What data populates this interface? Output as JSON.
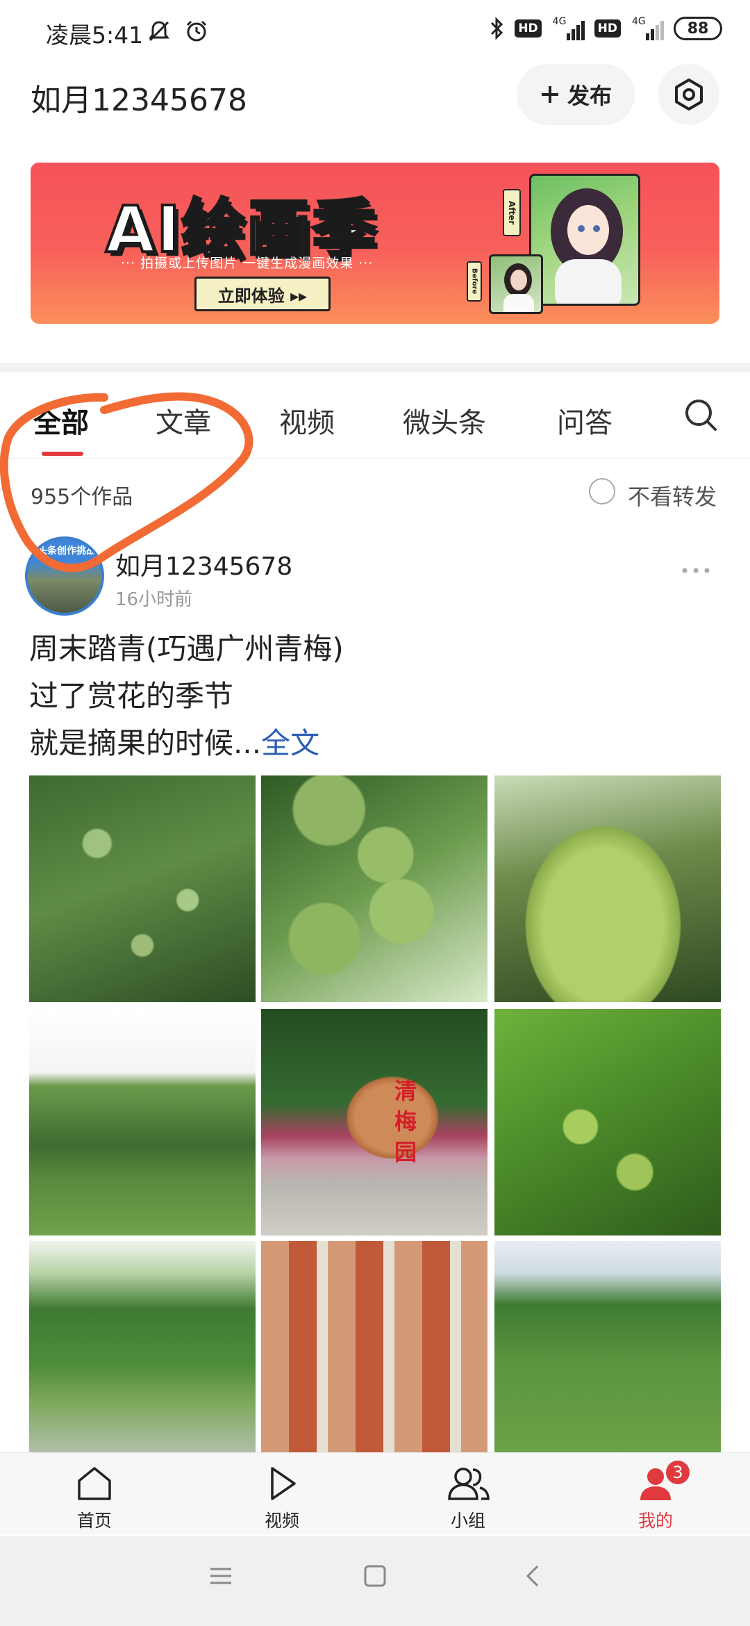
{
  "status_bar": {
    "time": "凌晨5:41",
    "hd1": "HD",
    "hd2": "HD",
    "net1": "4G",
    "net2": "4G",
    "battery": "88"
  },
  "header": {
    "username": "如月12345678",
    "publish_label": "发布"
  },
  "banner": {
    "title": "AI绘画季",
    "subtitle": "··· 拍摄或上传图片 一键生成漫画效果 ···",
    "cta": "立即体验 ▸▸",
    "after_tag": "After",
    "before_tag": "Before"
  },
  "tabs": [
    {
      "label": "全部"
    },
    {
      "label": "文章"
    },
    {
      "label": "视频"
    },
    {
      "label": "微头条"
    },
    {
      "label": "问答"
    }
  ],
  "works": {
    "count": "955个作品",
    "no_repost": "不看转发"
  },
  "post": {
    "avatar_text": "头条创作挑战",
    "author": "如月12345678",
    "time": "16小时前",
    "line1": "周末踏青(巧遇广州青梅)",
    "line2": "过了赏花的季节",
    "line3": "就是摘果的时候...",
    "read_more": "全文",
    "photo5_sign": "清梅园"
  },
  "bottom_nav": [
    {
      "label": "首页"
    },
    {
      "label": "视频"
    },
    {
      "label": "小组"
    },
    {
      "label": "我的"
    }
  ],
  "badge_count": "3",
  "colors": {
    "accent": "#e0393e",
    "link": "#2d5db3",
    "annotation": "#f26a34"
  }
}
